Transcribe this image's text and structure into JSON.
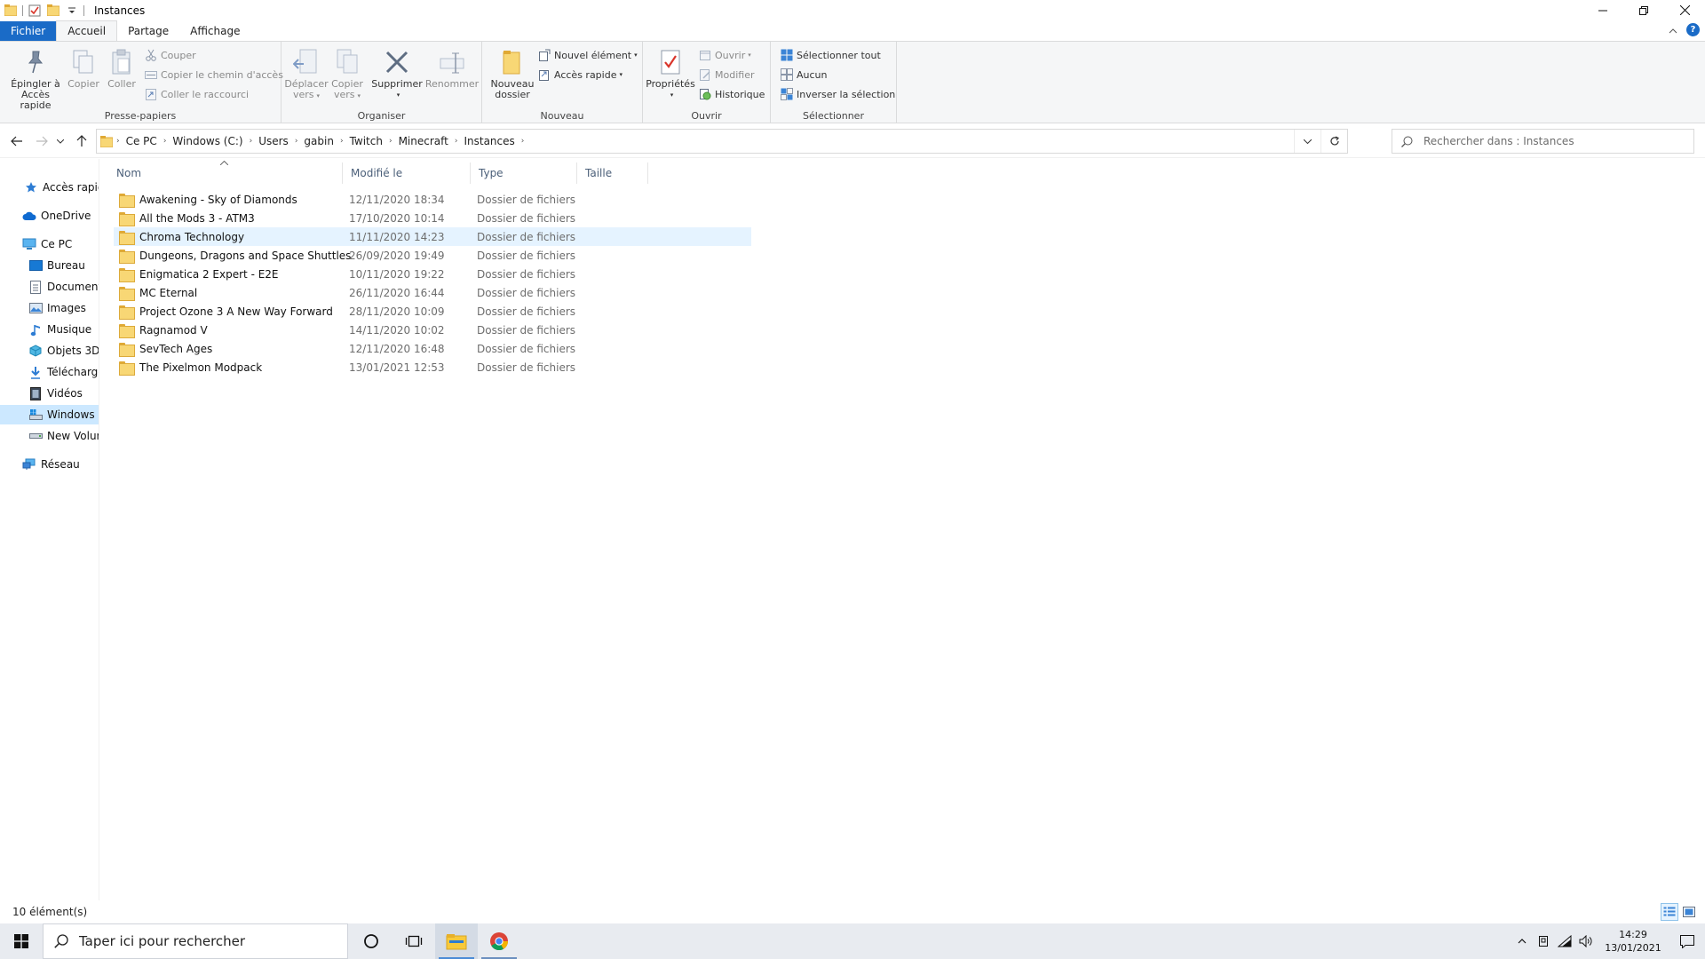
{
  "window": {
    "title": "Instances"
  },
  "ribbon_tabs": {
    "file": "Fichier",
    "home": "Accueil",
    "share": "Partage",
    "view": "Affichage"
  },
  "ribbon": {
    "clipboard": {
      "label": "Presse-papiers",
      "pin_line1": "Épingler à",
      "pin_line2": "Accès rapide",
      "copy": "Copier",
      "paste": "Coller",
      "cut": "Couper",
      "copy_path": "Copier le chemin d'accès",
      "paste_shortcut": "Coller le raccourci"
    },
    "organize": {
      "label": "Organiser",
      "move_line1": "Déplacer",
      "move_line2": "vers",
      "copyto_line1": "Copier",
      "copyto_line2": "vers",
      "delete": "Supprimer",
      "rename": "Renommer"
    },
    "new": {
      "label": "Nouveau",
      "newfolder_line1": "Nouveau",
      "newfolder_line2": "dossier",
      "new_item": "Nouvel élément",
      "easy_access": "Accès rapide"
    },
    "open": {
      "label": "Ouvrir",
      "properties": "Propriétés",
      "open": "Ouvrir",
      "edit": "Modifier",
      "history": "Historique"
    },
    "select": {
      "label": "Sélectionner",
      "select_all": "Sélectionner tout",
      "select_none": "Aucun",
      "invert": "Inverser la sélection"
    }
  },
  "address": {
    "crumbs": [
      "Ce PC",
      "Windows (C:)",
      "Users",
      "gabin",
      "Twitch",
      "Minecraft",
      "Instances"
    ],
    "search_placeholder": "Rechercher dans : Instances"
  },
  "nav": {
    "quick_access": "Accès rapide",
    "onedrive": "OneDrive",
    "this_pc": "Ce PC",
    "desktop": "Bureau",
    "documents": "Documents",
    "pictures": "Images",
    "music": "Musique",
    "objects3d": "Objets 3D",
    "downloads": "Téléchargements",
    "videos": "Vidéos",
    "drive_c": "Windows (C:)",
    "new_volume": "New Volume",
    "network": "Réseau"
  },
  "columns": {
    "name": "Nom",
    "modified": "Modifié le",
    "type": "Type",
    "size": "Taille"
  },
  "files": [
    {
      "name": " Awakening - Sky of Diamonds",
      "date": "12/11/2020 18:34",
      "type": "Dossier de fichiers"
    },
    {
      "name": "All the Mods 3 - ATM3",
      "date": "17/10/2020 10:14",
      "type": "Dossier de fichiers"
    },
    {
      "name": "Chroma Technology",
      "date": "11/11/2020 14:23",
      "type": "Dossier de fichiers"
    },
    {
      "name": "Dungeons, Dragons and Space Shuttles",
      "date": "26/09/2020 19:49",
      "type": "Dossier de fichiers"
    },
    {
      "name": "Enigmatica 2 Expert - E2E",
      "date": "10/11/2020 19:22",
      "type": "Dossier de fichiers"
    },
    {
      "name": "MC Eternal",
      "date": "26/11/2020 16:44",
      "type": "Dossier de fichiers"
    },
    {
      "name": "Project Ozone 3 A New Way Forward",
      "date": "28/11/2020 10:09",
      "type": "Dossier de fichiers"
    },
    {
      "name": "Ragnamod V",
      "date": "14/11/2020 10:02",
      "type": "Dossier de fichiers"
    },
    {
      "name": "SevTech Ages",
      "date": "12/11/2020 16:48",
      "type": "Dossier de fichiers"
    },
    {
      "name": "The Pixelmon Modpack",
      "date": "13/01/2021 12:53",
      "type": "Dossier de fichiers"
    }
  ],
  "status": {
    "count": "10 élément(s)"
  },
  "taskbar": {
    "search_placeholder": "Taper ici pour rechercher",
    "time": "14:29",
    "date": "13/01/2021"
  },
  "colors": {
    "accent": "#1a6bc7",
    "selection": "#cce8ff",
    "folder": "#f8d775"
  }
}
